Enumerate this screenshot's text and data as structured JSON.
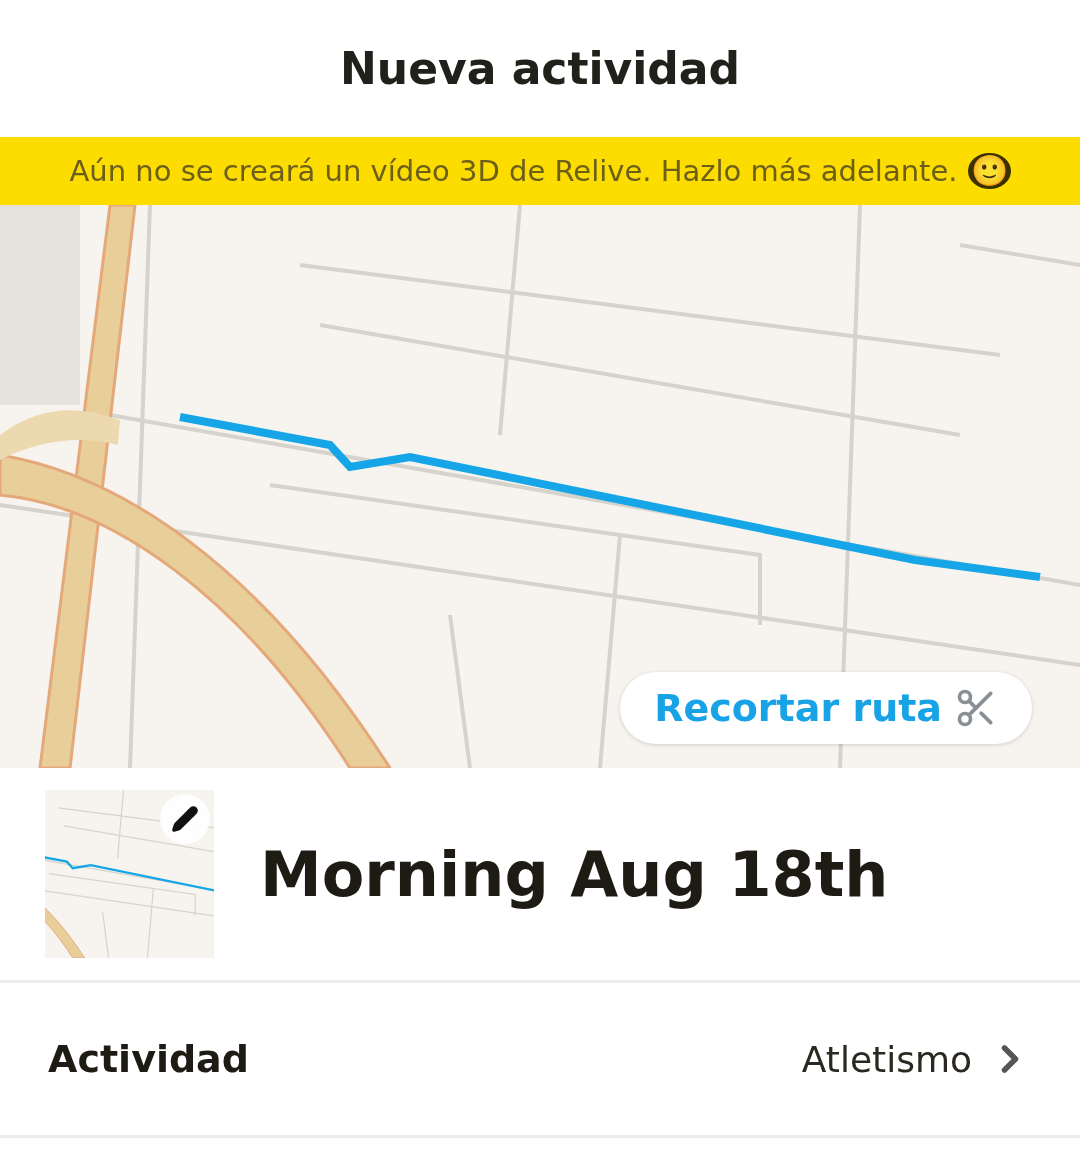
{
  "header": {
    "title": "Nueva actividad"
  },
  "banner": {
    "text": "Aún no se creará un vídeo 3D de Relive. Hazlo más adelante.",
    "emoji": "🙂"
  },
  "map": {
    "kind": "picture",
    "trim_button": {
      "label": "Recortar ruta"
    }
  },
  "activity": {
    "name": "Morning Aug 18th"
  },
  "settings": [
    {
      "label": "Actividad",
      "value": "Atletismo"
    }
  ]
}
